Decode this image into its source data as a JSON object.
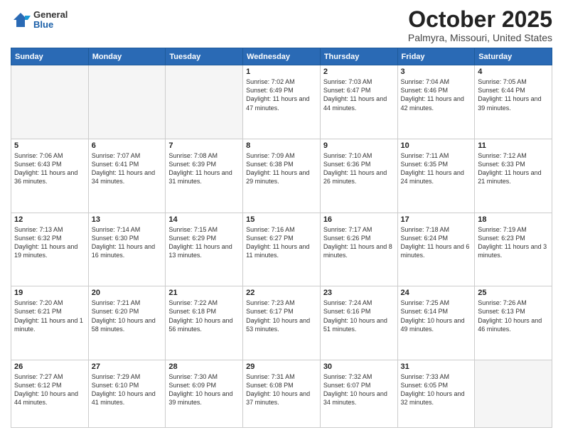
{
  "header": {
    "logo_general": "General",
    "logo_blue": "Blue",
    "title": "October 2025",
    "subtitle": "Palmyra, Missouri, United States"
  },
  "days_of_week": [
    "Sunday",
    "Monday",
    "Tuesday",
    "Wednesday",
    "Thursday",
    "Friday",
    "Saturday"
  ],
  "weeks": [
    [
      {
        "day": "",
        "content": ""
      },
      {
        "day": "",
        "content": ""
      },
      {
        "day": "",
        "content": ""
      },
      {
        "day": "1",
        "content": "Sunrise: 7:02 AM\nSunset: 6:49 PM\nDaylight: 11 hours and 47 minutes."
      },
      {
        "day": "2",
        "content": "Sunrise: 7:03 AM\nSunset: 6:47 PM\nDaylight: 11 hours and 44 minutes."
      },
      {
        "day": "3",
        "content": "Sunrise: 7:04 AM\nSunset: 6:46 PM\nDaylight: 11 hours and 42 minutes."
      },
      {
        "day": "4",
        "content": "Sunrise: 7:05 AM\nSunset: 6:44 PM\nDaylight: 11 hours and 39 minutes."
      }
    ],
    [
      {
        "day": "5",
        "content": "Sunrise: 7:06 AM\nSunset: 6:43 PM\nDaylight: 11 hours and 36 minutes."
      },
      {
        "day": "6",
        "content": "Sunrise: 7:07 AM\nSunset: 6:41 PM\nDaylight: 11 hours and 34 minutes."
      },
      {
        "day": "7",
        "content": "Sunrise: 7:08 AM\nSunset: 6:39 PM\nDaylight: 11 hours and 31 minutes."
      },
      {
        "day": "8",
        "content": "Sunrise: 7:09 AM\nSunset: 6:38 PM\nDaylight: 11 hours and 29 minutes."
      },
      {
        "day": "9",
        "content": "Sunrise: 7:10 AM\nSunset: 6:36 PM\nDaylight: 11 hours and 26 minutes."
      },
      {
        "day": "10",
        "content": "Sunrise: 7:11 AM\nSunset: 6:35 PM\nDaylight: 11 hours and 24 minutes."
      },
      {
        "day": "11",
        "content": "Sunrise: 7:12 AM\nSunset: 6:33 PM\nDaylight: 11 hours and 21 minutes."
      }
    ],
    [
      {
        "day": "12",
        "content": "Sunrise: 7:13 AM\nSunset: 6:32 PM\nDaylight: 11 hours and 19 minutes."
      },
      {
        "day": "13",
        "content": "Sunrise: 7:14 AM\nSunset: 6:30 PM\nDaylight: 11 hours and 16 minutes."
      },
      {
        "day": "14",
        "content": "Sunrise: 7:15 AM\nSunset: 6:29 PM\nDaylight: 11 hours and 13 minutes."
      },
      {
        "day": "15",
        "content": "Sunrise: 7:16 AM\nSunset: 6:27 PM\nDaylight: 11 hours and 11 minutes."
      },
      {
        "day": "16",
        "content": "Sunrise: 7:17 AM\nSunset: 6:26 PM\nDaylight: 11 hours and 8 minutes."
      },
      {
        "day": "17",
        "content": "Sunrise: 7:18 AM\nSunset: 6:24 PM\nDaylight: 11 hours and 6 minutes."
      },
      {
        "day": "18",
        "content": "Sunrise: 7:19 AM\nSunset: 6:23 PM\nDaylight: 11 hours and 3 minutes."
      }
    ],
    [
      {
        "day": "19",
        "content": "Sunrise: 7:20 AM\nSunset: 6:21 PM\nDaylight: 11 hours and 1 minute."
      },
      {
        "day": "20",
        "content": "Sunrise: 7:21 AM\nSunset: 6:20 PM\nDaylight: 10 hours and 58 minutes."
      },
      {
        "day": "21",
        "content": "Sunrise: 7:22 AM\nSunset: 6:18 PM\nDaylight: 10 hours and 56 minutes."
      },
      {
        "day": "22",
        "content": "Sunrise: 7:23 AM\nSunset: 6:17 PM\nDaylight: 10 hours and 53 minutes."
      },
      {
        "day": "23",
        "content": "Sunrise: 7:24 AM\nSunset: 6:16 PM\nDaylight: 10 hours and 51 minutes."
      },
      {
        "day": "24",
        "content": "Sunrise: 7:25 AM\nSunset: 6:14 PM\nDaylight: 10 hours and 49 minutes."
      },
      {
        "day": "25",
        "content": "Sunrise: 7:26 AM\nSunset: 6:13 PM\nDaylight: 10 hours and 46 minutes."
      }
    ],
    [
      {
        "day": "26",
        "content": "Sunrise: 7:27 AM\nSunset: 6:12 PM\nDaylight: 10 hours and 44 minutes."
      },
      {
        "day": "27",
        "content": "Sunrise: 7:29 AM\nSunset: 6:10 PM\nDaylight: 10 hours and 41 minutes."
      },
      {
        "day": "28",
        "content": "Sunrise: 7:30 AM\nSunset: 6:09 PM\nDaylight: 10 hours and 39 minutes."
      },
      {
        "day": "29",
        "content": "Sunrise: 7:31 AM\nSunset: 6:08 PM\nDaylight: 10 hours and 37 minutes."
      },
      {
        "day": "30",
        "content": "Sunrise: 7:32 AM\nSunset: 6:07 PM\nDaylight: 10 hours and 34 minutes."
      },
      {
        "day": "31",
        "content": "Sunrise: 7:33 AM\nSunset: 6:05 PM\nDaylight: 10 hours and 32 minutes."
      },
      {
        "day": "",
        "content": ""
      }
    ]
  ]
}
